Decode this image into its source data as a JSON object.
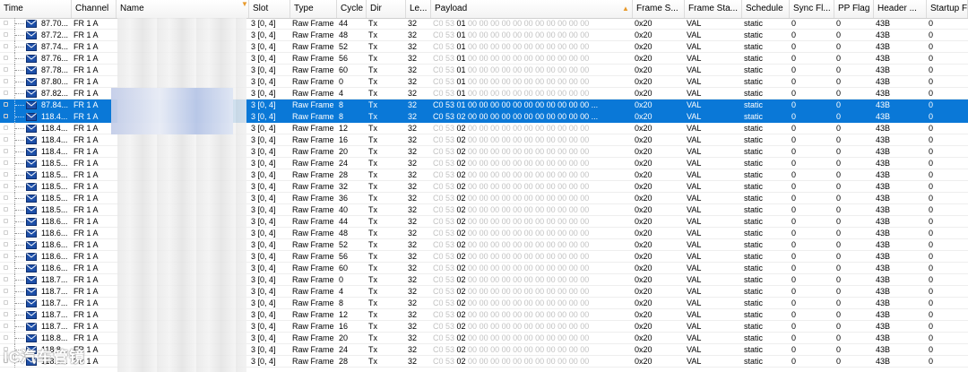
{
  "columns": [
    {
      "key": "time",
      "label": "Time"
    },
    {
      "key": "channel",
      "label": "Channel"
    },
    {
      "key": "name",
      "label": "Name"
    },
    {
      "key": "slot",
      "label": "Slot"
    },
    {
      "key": "type",
      "label": "Type"
    },
    {
      "key": "cycle",
      "label": "Cycle"
    },
    {
      "key": "dir",
      "label": "Dir"
    },
    {
      "key": "len",
      "label": "Le..."
    },
    {
      "key": "payload",
      "label": "Payload"
    },
    {
      "key": "frame_state",
      "label": "Frame S..."
    },
    {
      "key": "frame_status",
      "label": "Frame Sta..."
    },
    {
      "key": "schedule",
      "label": "Schedule"
    },
    {
      "key": "sync_flag",
      "label": "Sync Fl..."
    },
    {
      "key": "pp_flag",
      "label": "PP Flag"
    },
    {
      "key": "header",
      "label": "Header ..."
    },
    {
      "key": "startup",
      "label": "Startup F"
    }
  ],
  "sort_glyph_payload": "▲",
  "sort_glyph_name": "▼",
  "rows": [
    {
      "time": "87.70...",
      "channel": "FR 1 A",
      "slot": "3 [0, 4]",
      "type": "Raw Frame",
      "cycle": "44",
      "dir": "Tx",
      "len": "32",
      "payload": "C0 53 01 00 00 00 00 00 00 00 00 00 00 00",
      "frame_state": "0x20",
      "frame_status": "VAL",
      "schedule": "static",
      "sync_flag": "0",
      "pp_flag": "0",
      "header": "43B",
      "startup": "0"
    },
    {
      "time": "87.72...",
      "channel": "FR 1 A",
      "slot": "3 [0, 4]",
      "type": "Raw Frame",
      "cycle": "48",
      "dir": "Tx",
      "len": "32",
      "payload": "C0 53 01 00 00 00 00 00 00 00 00 00 00 00",
      "frame_state": "0x20",
      "frame_status": "VAL",
      "schedule": "static",
      "sync_flag": "0",
      "pp_flag": "0",
      "header": "43B",
      "startup": "0"
    },
    {
      "time": "87.74...",
      "channel": "FR 1 A",
      "slot": "3 [0, 4]",
      "type": "Raw Frame",
      "cycle": "52",
      "dir": "Tx",
      "len": "32",
      "payload": "C0 53 01 00 00 00 00 00 00 00 00 00 00 00",
      "frame_state": "0x20",
      "frame_status": "VAL",
      "schedule": "static",
      "sync_flag": "0",
      "pp_flag": "0",
      "header": "43B",
      "startup": "0"
    },
    {
      "time": "87.76...",
      "channel": "FR 1 A",
      "slot": "3 [0, 4]",
      "type": "Raw Frame",
      "cycle": "56",
      "dir": "Tx",
      "len": "32",
      "payload": "C0 53 01 00 00 00 00 00 00 00 00 00 00 00",
      "frame_state": "0x20",
      "frame_status": "VAL",
      "schedule": "static",
      "sync_flag": "0",
      "pp_flag": "0",
      "header": "43B",
      "startup": "0"
    },
    {
      "time": "87.78...",
      "channel": "FR 1 A",
      "slot": "3 [0, 4]",
      "type": "Raw Frame",
      "cycle": "60",
      "dir": "Tx",
      "len": "32",
      "payload": "C0 53 01 00 00 00 00 00 00 00 00 00 00 00",
      "frame_state": "0x20",
      "frame_status": "VAL",
      "schedule": "static",
      "sync_flag": "0",
      "pp_flag": "0",
      "header": "43B",
      "startup": "0"
    },
    {
      "time": "87.80...",
      "channel": "FR 1 A",
      "slot": "3 [0, 4]",
      "type": "Raw Frame",
      "cycle": "0",
      "dir": "Tx",
      "len": "32",
      "payload": "C0 53 01 00 00 00 00 00 00 00 00 00 00 00",
      "frame_state": "0x20",
      "frame_status": "VAL",
      "schedule": "static",
      "sync_flag": "0",
      "pp_flag": "0",
      "header": "43B",
      "startup": "0"
    },
    {
      "time": "87.82...",
      "channel": "FR 1 A",
      "slot": "3 [0, 4]",
      "type": "Raw Frame",
      "cycle": "4",
      "dir": "Tx",
      "len": "32",
      "payload": "C0 53 01 00 00 00 00 00 00 00 00 00 00 00",
      "frame_state": "0x20",
      "frame_status": "VAL",
      "schedule": "static",
      "sync_flag": "0",
      "pp_flag": "0",
      "header": "43B",
      "startup": "0"
    },
    {
      "time": "87.84...",
      "channel": "FR 1 A",
      "slot": "3 [0, 4]",
      "type": "Raw Frame",
      "cycle": "8",
      "dir": "Tx",
      "len": "32",
      "payload": "C0 53 01 00 00 00 00 00 00 00 00 00 00 00 ...",
      "frame_state": "0x20",
      "frame_status": "VAL",
      "schedule": "static",
      "sync_flag": "0",
      "pp_flag": "0",
      "header": "43B",
      "startup": "0",
      "selected": true
    },
    {
      "time": "118.4...",
      "channel": "FR 1 A",
      "slot": "3 [0, 4]",
      "type": "Raw Frame",
      "cycle": "8",
      "dir": "Tx",
      "len": "32",
      "payload": "C0 53 02 00 00 00 00 00 00 00 00 00 00 00 ...",
      "frame_state": "0x20",
      "frame_status": "VAL",
      "schedule": "static",
      "sync_flag": "0",
      "pp_flag": "0",
      "header": "43B",
      "startup": "0",
      "selected": true
    },
    {
      "time": "118.4...",
      "channel": "FR 1 A",
      "slot": "3 [0, 4]",
      "type": "Raw Frame",
      "cycle": "12",
      "dir": "Tx",
      "len": "32",
      "payload": "C0 53 02 00 00 00 00 00 00 00 00 00 00 00",
      "frame_state": "0x20",
      "frame_status": "VAL",
      "schedule": "static",
      "sync_flag": "0",
      "pp_flag": "0",
      "header": "43B",
      "startup": "0"
    },
    {
      "time": "118.4...",
      "channel": "FR 1 A",
      "slot": "3 [0, 4]",
      "type": "Raw Frame",
      "cycle": "16",
      "dir": "Tx",
      "len": "32",
      "payload": "C0 53 02 00 00 00 00 00 00 00 00 00 00 00",
      "frame_state": "0x20",
      "frame_status": "VAL",
      "schedule": "static",
      "sync_flag": "0",
      "pp_flag": "0",
      "header": "43B",
      "startup": "0"
    },
    {
      "time": "118.4...",
      "channel": "FR 1 A",
      "slot": "3 [0, 4]",
      "type": "Raw Frame",
      "cycle": "20",
      "dir": "Tx",
      "len": "32",
      "payload": "C0 53 02 00 00 00 00 00 00 00 00 00 00 00",
      "frame_state": "0x20",
      "frame_status": "VAL",
      "schedule": "static",
      "sync_flag": "0",
      "pp_flag": "0",
      "header": "43B",
      "startup": "0"
    },
    {
      "time": "118.5...",
      "channel": "FR 1 A",
      "slot": "3 [0, 4]",
      "type": "Raw Frame",
      "cycle": "24",
      "dir": "Tx",
      "len": "32",
      "payload": "C0 53 02 00 00 00 00 00 00 00 00 00 00 00",
      "frame_state": "0x20",
      "frame_status": "VAL",
      "schedule": "static",
      "sync_flag": "0",
      "pp_flag": "0",
      "header": "43B",
      "startup": "0"
    },
    {
      "time": "118.5...",
      "channel": "FR 1 A",
      "slot": "3 [0, 4]",
      "type": "Raw Frame",
      "cycle": "28",
      "dir": "Tx",
      "len": "32",
      "payload": "C0 53 02 00 00 00 00 00 00 00 00 00 00 00",
      "frame_state": "0x20",
      "frame_status": "VAL",
      "schedule": "static",
      "sync_flag": "0",
      "pp_flag": "0",
      "header": "43B",
      "startup": "0"
    },
    {
      "time": "118.5...",
      "channel": "FR 1 A",
      "slot": "3 [0, 4]",
      "type": "Raw Frame",
      "cycle": "32",
      "dir": "Tx",
      "len": "32",
      "payload": "C0 53 02 00 00 00 00 00 00 00 00 00 00 00",
      "frame_state": "0x20",
      "frame_status": "VAL",
      "schedule": "static",
      "sync_flag": "0",
      "pp_flag": "0",
      "header": "43B",
      "startup": "0"
    },
    {
      "time": "118.5...",
      "channel": "FR 1 A",
      "slot": "3 [0, 4]",
      "type": "Raw Frame",
      "cycle": "36",
      "dir": "Tx",
      "len": "32",
      "payload": "C0 53 02 00 00 00 00 00 00 00 00 00 00 00",
      "frame_state": "0x20",
      "frame_status": "VAL",
      "schedule": "static",
      "sync_flag": "0",
      "pp_flag": "0",
      "header": "43B",
      "startup": "0"
    },
    {
      "time": "118.5...",
      "channel": "FR 1 A",
      "slot": "3 [0, 4]",
      "type": "Raw Frame",
      "cycle": "40",
      "dir": "Tx",
      "len": "32",
      "payload": "C0 53 02 00 00 00 00 00 00 00 00 00 00 00",
      "frame_state": "0x20",
      "frame_status": "VAL",
      "schedule": "static",
      "sync_flag": "0",
      "pp_flag": "0",
      "header": "43B",
      "startup": "0"
    },
    {
      "time": "118.6...",
      "channel": "FR 1 A",
      "slot": "3 [0, 4]",
      "type": "Raw Frame",
      "cycle": "44",
      "dir": "Tx",
      "len": "32",
      "payload": "C0 53 02 00 00 00 00 00 00 00 00 00 00 00",
      "frame_state": "0x20",
      "frame_status": "VAL",
      "schedule": "static",
      "sync_flag": "0",
      "pp_flag": "0",
      "header": "43B",
      "startup": "0"
    },
    {
      "time": "118.6...",
      "channel": "FR 1 A",
      "slot": "3 [0, 4]",
      "type": "Raw Frame",
      "cycle": "48",
      "dir": "Tx",
      "len": "32",
      "payload": "C0 53 02 00 00 00 00 00 00 00 00 00 00 00",
      "frame_state": "0x20",
      "frame_status": "VAL",
      "schedule": "static",
      "sync_flag": "0",
      "pp_flag": "0",
      "header": "43B",
      "startup": "0"
    },
    {
      "time": "118.6...",
      "channel": "FR 1 A",
      "slot": "3 [0, 4]",
      "type": "Raw Frame",
      "cycle": "52",
      "dir": "Tx",
      "len": "32",
      "payload": "C0 53 02 00 00 00 00 00 00 00 00 00 00 00",
      "frame_state": "0x20",
      "frame_status": "VAL",
      "schedule": "static",
      "sync_flag": "0",
      "pp_flag": "0",
      "header": "43B",
      "startup": "0"
    },
    {
      "time": "118.6...",
      "channel": "FR 1 A",
      "slot": "3 [0, 4]",
      "type": "Raw Frame",
      "cycle": "56",
      "dir": "Tx",
      "len": "32",
      "payload": "C0 53 02 00 00 00 00 00 00 00 00 00 00 00",
      "frame_state": "0x20",
      "frame_status": "VAL",
      "schedule": "static",
      "sync_flag": "0",
      "pp_flag": "0",
      "header": "43B",
      "startup": "0"
    },
    {
      "time": "118.6...",
      "channel": "FR 1 A",
      "slot": "3 [0, 4]",
      "type": "Raw Frame",
      "cycle": "60",
      "dir": "Tx",
      "len": "32",
      "payload": "C0 53 02 00 00 00 00 00 00 00 00 00 00 00",
      "frame_state": "0x20",
      "frame_status": "VAL",
      "schedule": "static",
      "sync_flag": "0",
      "pp_flag": "0",
      "header": "43B",
      "startup": "0"
    },
    {
      "time": "118.7...",
      "channel": "FR 1 A",
      "slot": "3 [0, 4]",
      "type": "Raw Frame",
      "cycle": "0",
      "dir": "Tx",
      "len": "32",
      "payload": "C0 53 02 00 00 00 00 00 00 00 00 00 00 00",
      "frame_state": "0x20",
      "frame_status": "VAL",
      "schedule": "static",
      "sync_flag": "0",
      "pp_flag": "0",
      "header": "43B",
      "startup": "0"
    },
    {
      "time": "118.7...",
      "channel": "FR 1 A",
      "slot": "3 [0, 4]",
      "type": "Raw Frame",
      "cycle": "4",
      "dir": "Tx",
      "len": "32",
      "payload": "C0 53 02 00 00 00 00 00 00 00 00 00 00 00",
      "frame_state": "0x20",
      "frame_status": "VAL",
      "schedule": "static",
      "sync_flag": "0",
      "pp_flag": "0",
      "header": "43B",
      "startup": "0"
    },
    {
      "time": "118.7...",
      "channel": "FR 1 A",
      "slot": "3 [0, 4]",
      "type": "Raw Frame",
      "cycle": "8",
      "dir": "Tx",
      "len": "32",
      "payload": "C0 53 02 00 00 00 00 00 00 00 00 00 00 00",
      "frame_state": "0x20",
      "frame_status": "VAL",
      "schedule": "static",
      "sync_flag": "0",
      "pp_flag": "0",
      "header": "43B",
      "startup": "0"
    },
    {
      "time": "118.7...",
      "channel": "FR 1 A",
      "slot": "3 [0, 4]",
      "type": "Raw Frame",
      "cycle": "12",
      "dir": "Tx",
      "len": "32",
      "payload": "C0 53 02 00 00 00 00 00 00 00 00 00 00 00",
      "frame_state": "0x20",
      "frame_status": "VAL",
      "schedule": "static",
      "sync_flag": "0",
      "pp_flag": "0",
      "header": "43B",
      "startup": "0"
    },
    {
      "time": "118.7...",
      "channel": "FR 1 A",
      "slot": "3 [0, 4]",
      "type": "Raw Frame",
      "cycle": "16",
      "dir": "Tx",
      "len": "32",
      "payload": "C0 53 02 00 00 00 00 00 00 00 00 00 00 00",
      "frame_state": "0x20",
      "frame_status": "VAL",
      "schedule": "static",
      "sync_flag": "0",
      "pp_flag": "0",
      "header": "43B",
      "startup": "0"
    },
    {
      "time": "118.8...",
      "channel": "FR 1 A",
      "slot": "3 [0, 4]",
      "type": "Raw Frame",
      "cycle": "20",
      "dir": "Tx",
      "len": "32",
      "payload": "C0 53 02 00 00 00 00 00 00 00 00 00 00 00",
      "frame_state": "0x20",
      "frame_status": "VAL",
      "schedule": "static",
      "sync_flag": "0",
      "pp_flag": "0",
      "header": "43B",
      "startup": "0"
    },
    {
      "time": "118.8...",
      "channel": "FR 1 A",
      "slot": "3 [0, 4]",
      "type": "Raw Frame",
      "cycle": "24",
      "dir": "Tx",
      "len": "32",
      "payload": "C0 53 02 00 00 00 00 00 00 00 00 00 00 00",
      "frame_state": "0x20",
      "frame_status": "VAL",
      "schedule": "static",
      "sync_flag": "0",
      "pp_flag": "0",
      "header": "43B",
      "startup": "0"
    },
    {
      "time": "118.8...",
      "channel": "FR 1 A",
      "slot": "3 [0, 4]",
      "type": "Raw Frame",
      "cycle": "28",
      "dir": "Tx",
      "len": "32",
      "payload": "C0 53 02 00 00 00 00 00 00 00 00 00 00 00",
      "frame_state": "0x20",
      "frame_status": "VAL",
      "schedule": "static",
      "sync_flag": "0",
      "pp_flag": "0",
      "header": "43B",
      "startup": "0"
    }
  ],
  "watermark": "IC汽车管镜",
  "colors": {
    "selection": "#0a78d7",
    "sort_glyph": "#e89a2c",
    "grey_payload": "#c2c2c2"
  }
}
